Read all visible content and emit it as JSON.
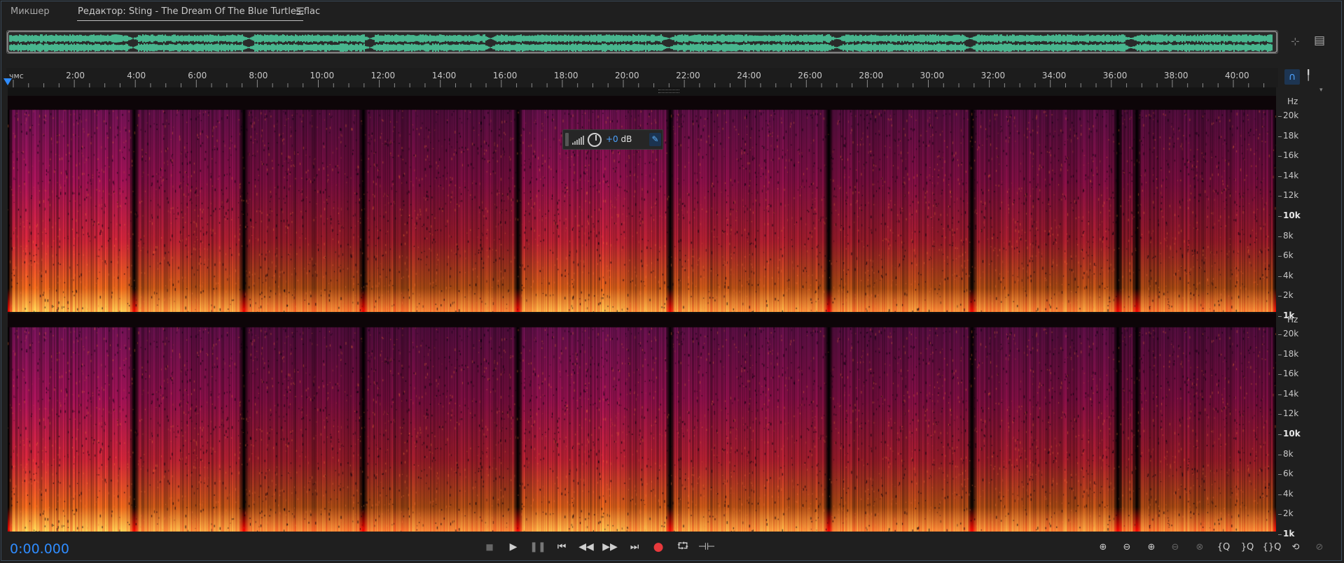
{
  "tabs": {
    "mixer": "Микшер",
    "editor": "Редактор: Sting - The Dream Of The Blue Turtles.flac",
    "menu_icon": "hamburger-menu-icon"
  },
  "ruler": {
    "unit": "чмс",
    "labels": [
      "2:00",
      "4:00",
      "6:00",
      "8:00",
      "10:00",
      "12:00",
      "14:00",
      "16:00",
      "18:00",
      "20:00",
      "22:00",
      "24:00",
      "26:00",
      "28:00",
      "30:00",
      "32:00",
      "34:00",
      "36:00",
      "38:00",
      "40:00"
    ]
  },
  "hz_axis": {
    "unit": "Hz",
    "labels": [
      "20k",
      "18k",
      "16k",
      "14k",
      "12k",
      "10k",
      "8k",
      "6k",
      "4k",
      "2k",
      "1k"
    ]
  },
  "hud": {
    "value": "+0",
    "unit": " dB"
  },
  "transport": {
    "time": "0:00.000",
    "buttons": [
      "stop",
      "play",
      "pause",
      "go-to-start",
      "rewind",
      "fast-forward",
      "go-to-end",
      "record",
      "loop",
      "skip-selection"
    ]
  },
  "zoom": {
    "buttons": [
      "zoom-in-amplitude",
      "zoom-out-amplitude",
      "zoom-in-time",
      "zoom-out-time",
      "zoom-out-full",
      "zoom-in-selection",
      "zoom-left-selection",
      "zoom-right-selection",
      "zoom-out-both",
      "zoom-reset"
    ]
  },
  "colors": {
    "accent": "#2f8cff",
    "waveform": "#4fd9a8",
    "record": "#e8393c"
  }
}
